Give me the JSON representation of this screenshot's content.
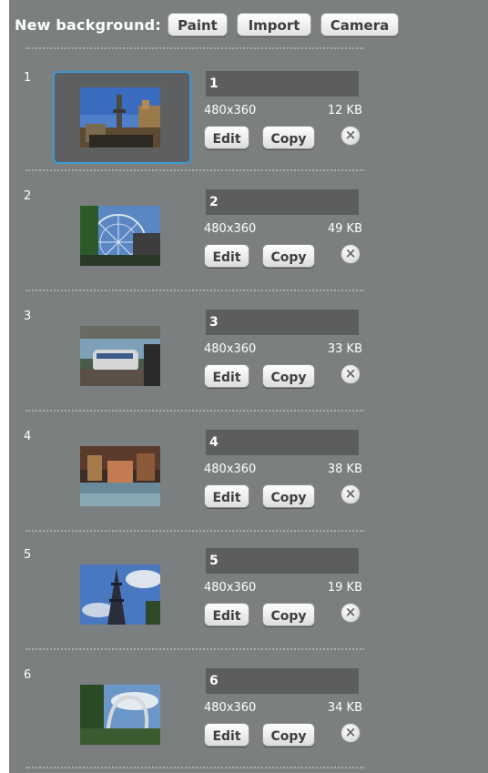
{
  "toolbar": {
    "label": "New background:",
    "paint_label": "Paint",
    "import_label": "Import",
    "camera_label": "Camera"
  },
  "backgrounds": [
    {
      "index": "1",
      "name": "1",
      "dimensions": "480x360",
      "size": "12 KB",
      "edit_label": "Edit",
      "copy_label": "Copy",
      "delete_icon": "×",
      "selected": true
    },
    {
      "index": "2",
      "name": "2",
      "dimensions": "480x360",
      "size": "49 KB",
      "edit_label": "Edit",
      "copy_label": "Copy",
      "delete_icon": "×",
      "selected": false
    },
    {
      "index": "3",
      "name": "3",
      "dimensions": "480x360",
      "size": "33 KB",
      "edit_label": "Edit",
      "copy_label": "Copy",
      "delete_icon": "×",
      "selected": false
    },
    {
      "index": "4",
      "name": "4",
      "dimensions": "480x360",
      "size": "38 KB",
      "edit_label": "Edit",
      "copy_label": "Copy",
      "delete_icon": "×",
      "selected": false
    },
    {
      "index": "5",
      "name": "5",
      "dimensions": "480x360",
      "size": "19 KB",
      "edit_label": "Edit",
      "copy_label": "Copy",
      "delete_icon": "×",
      "selected": false
    },
    {
      "index": "6",
      "name": "6",
      "dimensions": "480x360",
      "size": "34 KB",
      "edit_label": "Edit",
      "copy_label": "Copy",
      "delete_icon": "×",
      "selected": false
    }
  ],
  "colors": {
    "panel_bg": "#7c7f80",
    "selection_border": "#3b97d3",
    "name_field_bg": "#5b5d5f"
  }
}
